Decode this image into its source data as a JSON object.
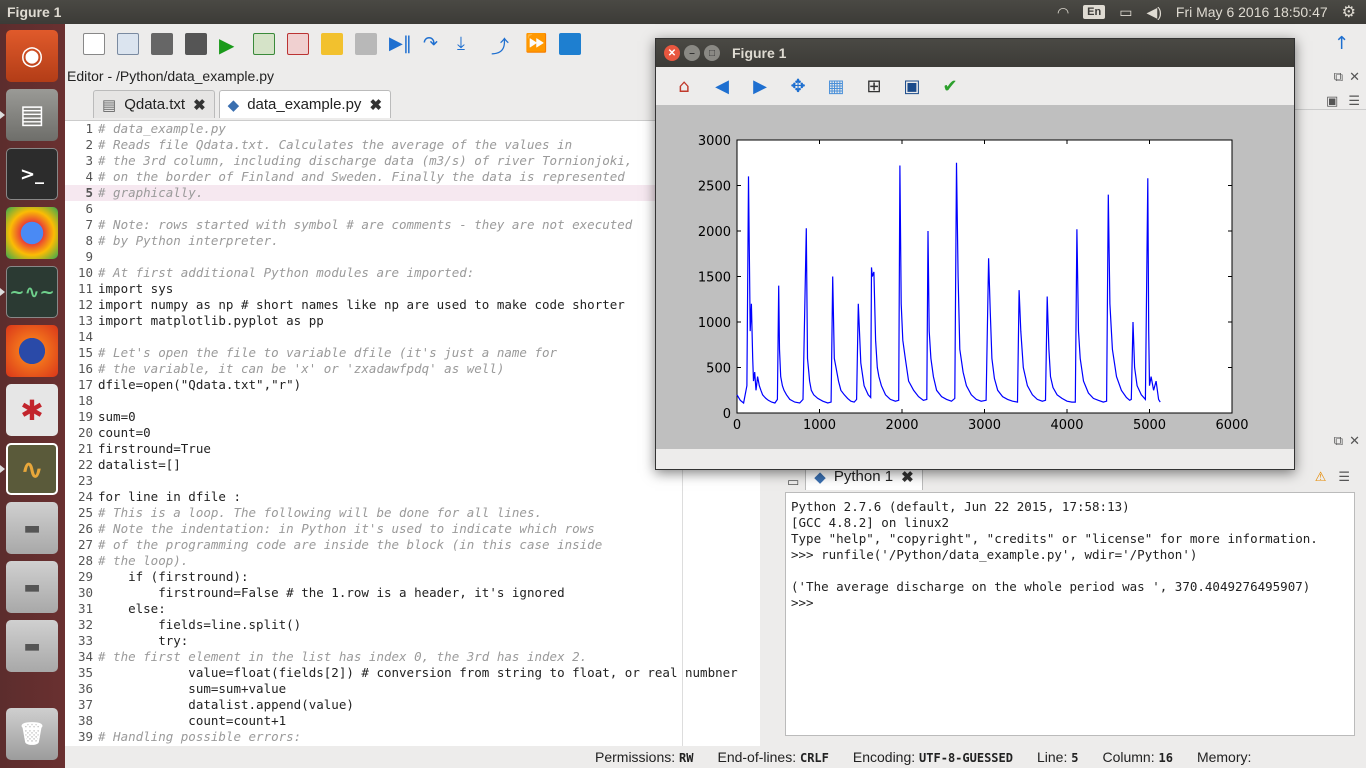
{
  "topbar": {
    "title": "Figure 1",
    "lang": "En",
    "clock": "Fri May  6 2016 18:50:47"
  },
  "editor": {
    "title": "Editor - /Python/data_example.py",
    "tabs": [
      {
        "label": "Qdata.txt"
      },
      {
        "label": "data_example.py"
      }
    ],
    "lines": [
      {
        "n": "1",
        "text": "# data_example.py",
        "type": "comment"
      },
      {
        "n": "2",
        "text": "# Reads file Qdata.txt. Calculates the average of the values in",
        "type": "comment"
      },
      {
        "n": "3",
        "text": "# the 3rd column, including discharge data (m3/s) of river Tornionjoki,",
        "type": "comment"
      },
      {
        "n": "4",
        "text": "# on the border of Finland and Sweden. Finally the data is represented",
        "type": "comment"
      },
      {
        "n": "5",
        "text": "# graphically.",
        "type": "comment"
      },
      {
        "n": "6",
        "text": "",
        "type": "code"
      },
      {
        "n": "7",
        "text": "# Note: rows started with symbol # are comments - they are not executed",
        "type": "comment"
      },
      {
        "n": "8",
        "text": "# by Python interpreter.",
        "type": "comment"
      },
      {
        "n": "9",
        "text": "",
        "type": "code"
      },
      {
        "n": "10",
        "text": "# At first additional Python modules are imported:",
        "type": "comment"
      },
      {
        "n": "11",
        "text": "import sys",
        "type": "code"
      },
      {
        "n": "12",
        "text": "import numpy as np # short names like np are used to make code shorter",
        "type": "code"
      },
      {
        "n": "13",
        "text": "import matplotlib.pyplot as pp",
        "type": "code"
      },
      {
        "n": "14",
        "text": "",
        "type": "code"
      },
      {
        "n": "15",
        "text": "# Let's open the file to variable dfile (it's just a name for",
        "type": "comment"
      },
      {
        "n": "16",
        "text": "# the variable, it can be 'x' or 'zxadawfpdq' as well)",
        "type": "comment"
      },
      {
        "n": "17",
        "text": "dfile=open(\"Qdata.txt\",\"r\")",
        "type": "code"
      },
      {
        "n": "18",
        "text": "",
        "type": "code"
      },
      {
        "n": "19",
        "text": "sum=0",
        "type": "code"
      },
      {
        "n": "20",
        "text": "count=0",
        "type": "code"
      },
      {
        "n": "21",
        "text": "firstround=True",
        "type": "code"
      },
      {
        "n": "22",
        "text": "datalist=[]",
        "type": "code"
      },
      {
        "n": "23",
        "text": "",
        "type": "code"
      },
      {
        "n": "24",
        "text": "for line in dfile :",
        "type": "code"
      },
      {
        "n": "25",
        "text": "# This is a loop. The following will be done for all lines.",
        "type": "comment"
      },
      {
        "n": "26",
        "text": "# Note the indentation: in Python it's used to indicate which rows",
        "type": "comment"
      },
      {
        "n": "27",
        "text": "# of the programming code are inside the block (in this case inside",
        "type": "comment"
      },
      {
        "n": "28",
        "text": "# the loop).",
        "type": "comment"
      },
      {
        "n": "29",
        "text": "    if (firstround):",
        "type": "code"
      },
      {
        "n": "30",
        "text": "        firstround=False # the 1.row is a header, it's ignored",
        "type": "code"
      },
      {
        "n": "31",
        "text": "    else:",
        "type": "code"
      },
      {
        "n": "32",
        "text": "        fields=line.split()",
        "type": "code"
      },
      {
        "n": "33",
        "text": "        try:",
        "type": "code"
      },
      {
        "n": "34",
        "text": "# the first element in the list has index 0, the 3rd has index 2.",
        "type": "comment"
      },
      {
        "n": "35",
        "text": "            value=float(fields[2]) # conversion from string to float, or real numbner",
        "type": "code"
      },
      {
        "n": "36",
        "text": "            sum=sum+value",
        "type": "code"
      },
      {
        "n": "37",
        "text": "            datalist.append(value)",
        "type": "code"
      },
      {
        "n": "38",
        "text": "            count=count+1",
        "type": "code"
      },
      {
        "n": "39",
        "text": "# Handling possible errors:",
        "type": "comment"
      }
    ],
    "highlight_line": "5"
  },
  "statusbar": {
    "permissions_label": "Permissions:",
    "permissions_value": "RW",
    "eol_label": "End-of-lines:",
    "eol_value": "CRLF",
    "encoding_label": "Encoding:",
    "encoding_value": "UTF-8-GUESSED",
    "line_label": "Line:",
    "line_value": "5",
    "column_label": "Column:",
    "column_value": "16",
    "memory_label": "Memory:"
  },
  "console": {
    "tab_label": "Python 1",
    "output": [
      "Python 2.7.6 (default, Jun 22 2015, 17:58:13)",
      "[GCC 4.8.2] on linux2",
      "Type \"help\", \"copyright\", \"credits\" or \"license\" for more information.",
      ">>> runfile('/Python/data_example.py', wdir='/Python')",
      "",
      "('The average discharge on the whole period was ', 370.4049276495907)",
      ">>>"
    ]
  },
  "figure": {
    "title": "Figure 1"
  },
  "chart_data": {
    "type": "line",
    "title": "",
    "xlabel": "",
    "ylabel": "",
    "xlim": [
      0,
      6000
    ],
    "ylim": [
      0,
      3000
    ],
    "xticks": [
      0,
      1000,
      2000,
      3000,
      4000,
      5000,
      6000
    ],
    "yticks": [
      0,
      500,
      1000,
      1500,
      2000,
      2500,
      3000
    ],
    "grid": false,
    "color": "#0000ff",
    "series": [
      {
        "x": [
          0,
          40,
          80,
          120,
          140,
          150,
          160,
          175,
          190,
          200,
          215,
          230,
          250,
          270,
          290,
          310,
          330,
          350,
          380,
          420,
          460,
          490,
          505,
          515,
          530,
          550,
          570,
          600,
          640,
          700,
          760,
          800,
          840,
          855,
          870,
          880,
          900,
          930,
          980,
          1040,
          1100,
          1140,
          1160,
          1180,
          1200,
          1230,
          1260,
          1300,
          1340,
          1380,
          1420,
          1450,
          1470,
          1500,
          1540,
          1590,
          1620,
          1630,
          1640,
          1660,
          1680,
          1700,
          1720,
          1750,
          1800,
          1860,
          1920,
          1960,
          1975,
          1990,
          2010,
          2040,
          2080,
          2140,
          2200,
          2260,
          2300,
          2315,
          2330,
          2350,
          2380,
          2420,
          2480,
          2540,
          2600,
          2640,
          2660,
          2680,
          2700,
          2740,
          2780,
          2840,
          2900,
          2960,
          3020,
          3050,
          3070,
          3090,
          3120,
          3160,
          3220,
          3280,
          3340,
          3400,
          3420,
          3440,
          3470,
          3520,
          3580,
          3640,
          3700,
          3740,
          3760,
          3780,
          3800,
          3830,
          3880,
          3940,
          4000,
          4060,
          4100,
          4120,
          4140,
          4160,
          4200,
          4260,
          4320,
          4380,
          4440,
          4480,
          4500,
          4520,
          4550,
          4600,
          4660,
          4720,
          4760,
          4780,
          4800,
          4820,
          4850,
          4900,
          4950,
          4980,
          4990,
          5000,
          5020,
          5050,
          5080,
          5110,
          5130
        ],
        "y": [
          200,
          140,
          110,
          300,
          2600,
          1700,
          900,
          1200,
          600,
          350,
          450,
          250,
          400,
          300,
          250,
          200,
          180,
          160,
          140,
          120,
          110,
          150,
          1400,
          700,
          400,
          300,
          250,
          200,
          150,
          120,
          110,
          150,
          2030,
          600,
          450,
          350,
          250,
          200,
          160,
          130,
          110,
          120,
          1500,
          600,
          500,
          350,
          250,
          200,
          160,
          130,
          120,
          150,
          1200,
          550,
          300,
          200,
          170,
          1600,
          1500,
          1550,
          800,
          500,
          400,
          300,
          200,
          150,
          130,
          140,
          2720,
          1200,
          800,
          600,
          350,
          250,
          180,
          140,
          150,
          2000,
          900,
          600,
          400,
          250,
          180,
          150,
          130,
          160,
          2750,
          1500,
          700,
          450,
          300,
          200,
          150,
          130,
          140,
          1700,
          1100,
          600,
          380,
          250,
          180,
          150,
          130,
          120,
          1350,
          900,
          500,
          300,
          200,
          150,
          130,
          140,
          1280,
          700,
          400,
          280,
          200,
          160,
          130,
          120,
          120,
          2020,
          900,
          600,
          350,
          220,
          160,
          140,
          120,
          130,
          2400,
          1200,
          700,
          400,
          250,
          170,
          140,
          150,
          1000,
          500,
          300,
          200,
          150,
          2580,
          900,
          300,
          400,
          250,
          350,
          150,
          120
        ]
      }
    ]
  }
}
